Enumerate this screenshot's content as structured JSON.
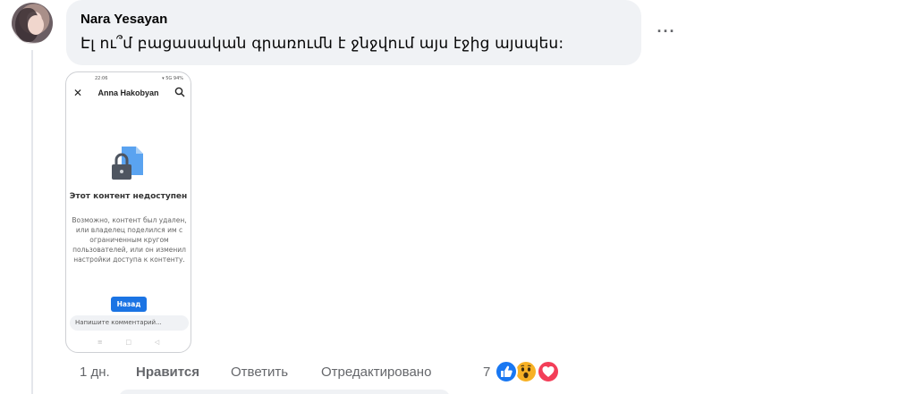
{
  "comment": {
    "author": "Nara Yesayan",
    "text": "Էլ ու՞մ բացասական գրառումն է ջնջվում այս էջից այսպես:",
    "more_label": "···"
  },
  "attachment": {
    "status_left": "22:06",
    "status_right": "▾ 5G 94%",
    "close_icon": "✕",
    "title": "Anna Hakobyan",
    "heading": "Этот контент недоступен",
    "body": "Возможно, контент был удален, или владелец поделился им с ограниченным кругом пользователей, или он изменил настройки доступа к контенту.",
    "button": "Назад",
    "input_placeholder": "Напишите комментарий...",
    "nav": [
      "≡",
      "□",
      "◁"
    ]
  },
  "actions": {
    "time": "1 дн.",
    "like": "Нравится",
    "reply": "Ответить",
    "edited": "Отредактировано",
    "reaction_count": "7"
  },
  "colors": {
    "bubble": "#f0f2f5",
    "like_blue": "#1877f2",
    "wow_yellow": "#f7b125",
    "love_red": "#f33e58",
    "secondary_text": "#65676b"
  }
}
